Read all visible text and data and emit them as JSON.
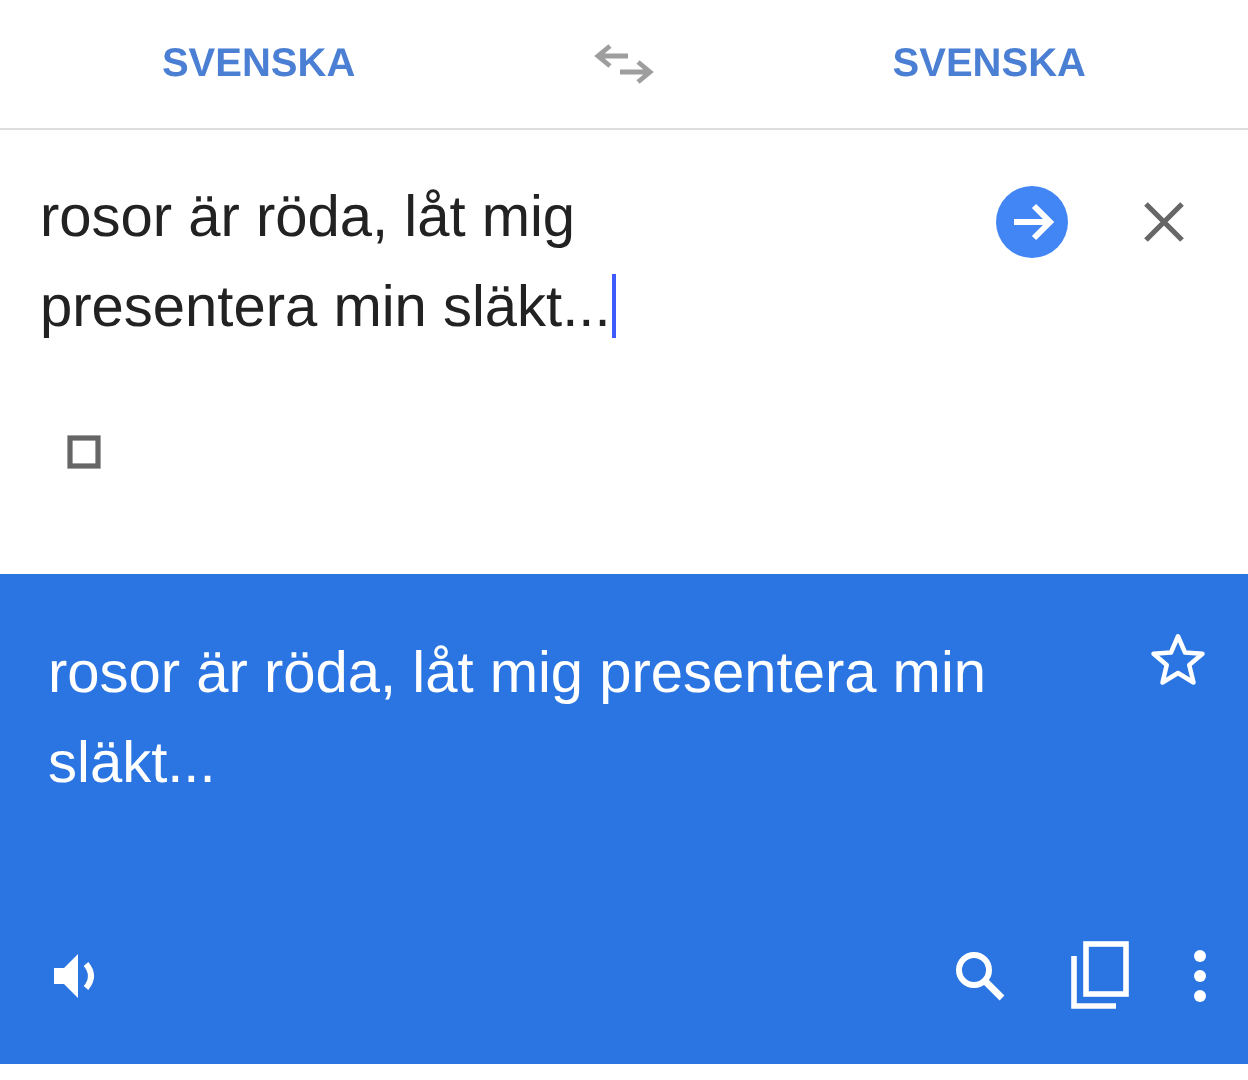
{
  "languages": {
    "source": "SVENSKA",
    "target": "SVENSKA"
  },
  "input": {
    "value": "rosor är röda, låt mig presentera min släkt..."
  },
  "translation": {
    "text": "rosor är röda, låt mig presentera min släkt...",
    "starred": false
  }
}
